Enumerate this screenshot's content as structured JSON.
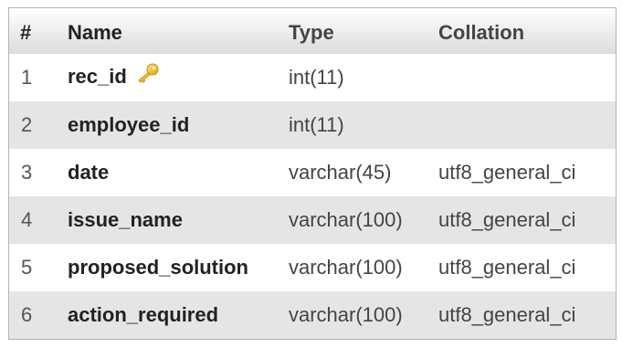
{
  "table": {
    "headers": {
      "num": "#",
      "name": "Name",
      "type": "Type",
      "collation": "Collation"
    },
    "rows": [
      {
        "num": "1",
        "name": "rec_id",
        "type": "int(11)",
        "collation": "",
        "primary_key_icon": "key-icon"
      },
      {
        "num": "2",
        "name": "employee_id",
        "type": "int(11)",
        "collation": ""
      },
      {
        "num": "3",
        "name": "date",
        "type": "varchar(45)",
        "collation": "utf8_general_ci"
      },
      {
        "num": "4",
        "name": "issue_name",
        "type": "varchar(100)",
        "collation": "utf8_general_ci"
      },
      {
        "num": "5",
        "name": "proposed_solution",
        "type": "varchar(100)",
        "collation": "utf8_general_ci"
      },
      {
        "num": "6",
        "name": "action_required",
        "type": "varchar(100)",
        "collation": "utf8_general_ci"
      }
    ]
  },
  "colors": {
    "row_alt": "#e5e5e5",
    "key_icon": "#f2c11c"
  }
}
